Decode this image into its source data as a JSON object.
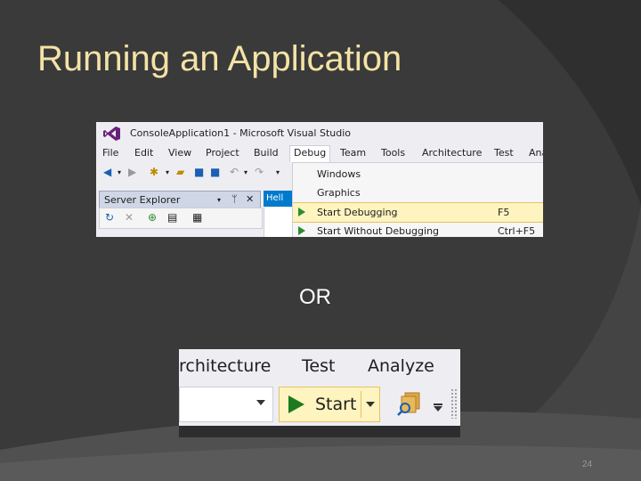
{
  "slide": {
    "title": "Running an Application",
    "or_text": "OR",
    "page_number": "24"
  },
  "vs_window": {
    "title": "ConsoleApplication1 - Microsoft Visual Studio",
    "menu": [
      "File",
      "Edit",
      "View",
      "Project",
      "Build",
      "Debug",
      "Team",
      "Tools",
      "Architecture",
      "Test",
      "Ana"
    ],
    "active_menu": "Debug",
    "panel_title": "Server Explorer",
    "doc_tab": "Hell",
    "debug_menu": [
      {
        "label": "Windows",
        "shortcut": ""
      },
      {
        "label": "Graphics",
        "shortcut": ""
      },
      {
        "label": "Start Debugging",
        "shortcut": "F5",
        "highlighted": true
      },
      {
        "label": "Start Without Debugging",
        "shortcut": "Ctrl+F5"
      }
    ],
    "colors": {
      "accent": "#007acc",
      "highlight": "#fdf4bf",
      "play": "#2e8b2e",
      "logo": "#68217a"
    }
  },
  "toolbar_zoom": {
    "menu": [
      "rchitecture",
      "Test",
      "Analyze"
    ],
    "start_label": "Start",
    "icons": [
      "play-icon",
      "dropdown-arrow-icon",
      "find-in-files-icon",
      "toolbar-overflow-icon"
    ]
  }
}
